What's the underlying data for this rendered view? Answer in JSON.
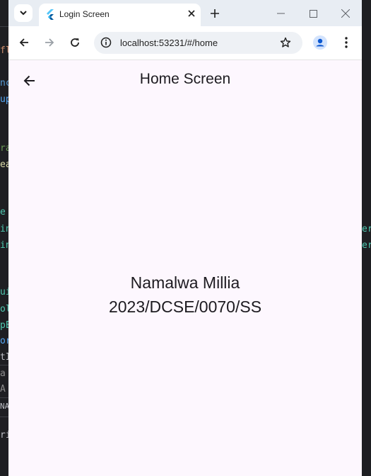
{
  "browser": {
    "tab_title": "Login Screen",
    "url": "localhost:53231/#/home"
  },
  "app": {
    "title": "Home Screen",
    "name": "Namalwa Millia",
    "reg_number": "2023/DCSE/0070/SS"
  },
  "background_code": {
    "fragments": [
      "fl",
      "nc",
      "up",
      "ra",
      "ea",
      "e",
      "in",
      "in",
      "ui",
      "ol",
      "pE",
      "or",
      "tI",
      "a",
      "A",
      "NA",
      "ri",
      "er",
      "er"
    ]
  },
  "icons": {
    "tab_search": "chevron-down-icon",
    "favicon": "flutter-icon",
    "tab_close": "close-icon",
    "new_tab": "plus-icon",
    "minimize": "minimize-icon",
    "maximize": "maximize-icon",
    "close_window": "close-icon",
    "back": "arrow-left-icon",
    "forward": "arrow-right-icon",
    "reload": "reload-icon",
    "site_info": "info-icon",
    "bookmark": "star-icon",
    "profile": "profile-icon",
    "menu": "kebab-menu-icon",
    "app_back": "arrow-left-icon"
  },
  "colors": {
    "app_background": "#fdf7fe",
    "tabbar_background": "#e8edf3",
    "text": "#1d1b20"
  }
}
